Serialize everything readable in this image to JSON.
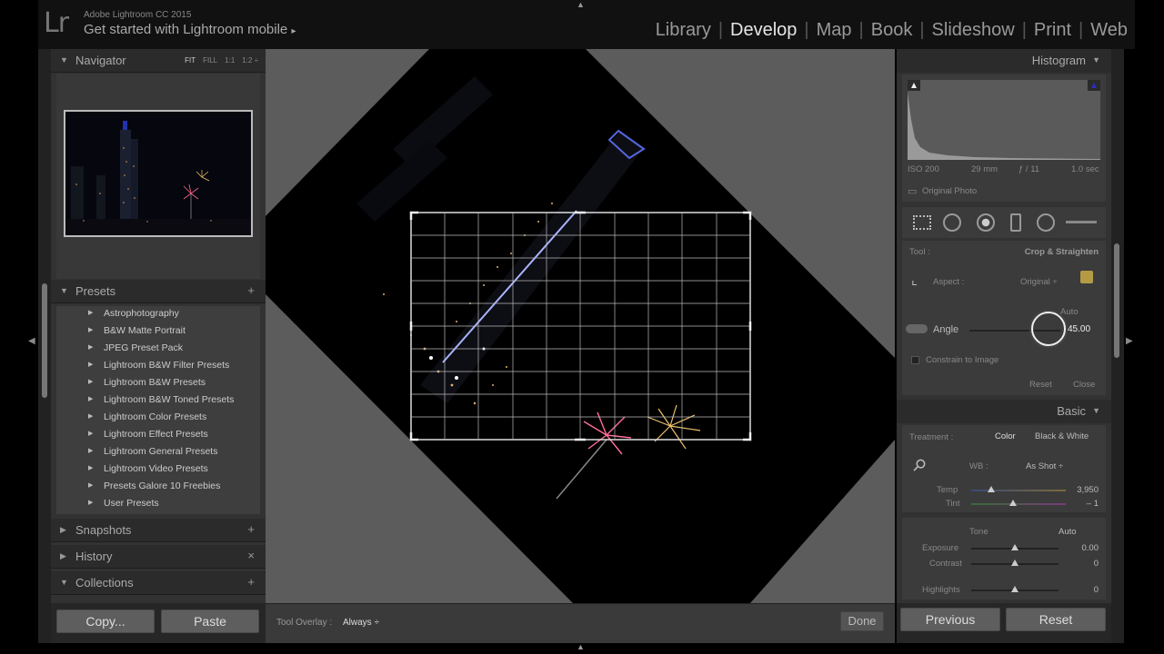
{
  "app": {
    "logo": "Lr",
    "subtitle": "Adobe Lightroom CC 2015",
    "title": "Get started with Lightroom mobile",
    "title_arrow": "▸"
  },
  "modules": [
    "Library",
    "Develop",
    "Map",
    "Book",
    "Slideshow",
    "Print",
    "Web"
  ],
  "active_module": "Develop",
  "navigator": {
    "title": "Navigator",
    "zoom_options": [
      "FIT",
      "FILL",
      "1:1",
      "1:2 ÷"
    ]
  },
  "presets": {
    "title": "Presets",
    "add": "+",
    "items": [
      "Astrophotography",
      "B&W Matte Portrait",
      "JPEG Preset Pack",
      "Lightroom B&W Filter Presets",
      "Lightroom B&W Presets",
      "Lightroom B&W Toned Presets",
      "Lightroom Color Presets",
      "Lightroom Effect Presets",
      "Lightroom General Presets",
      "Lightroom Video Presets",
      "Presets Galore 10 Freebies",
      "User Presets"
    ]
  },
  "snapshots": {
    "title": "Snapshots",
    "action": "+"
  },
  "history": {
    "title": "History",
    "action": "×"
  },
  "collections": {
    "title": "Collections",
    "action": "+"
  },
  "left_buttons": {
    "copy": "Copy...",
    "paste": "Paste"
  },
  "toolbar": {
    "overlay_label": "Tool Overlay :",
    "overlay_value": "Always ÷",
    "done": "Done"
  },
  "histogram": {
    "title": "Histogram",
    "iso": "ISO 200",
    "focal": "29 mm",
    "aperture": "ƒ / 11",
    "shutter": "1.0 sec",
    "original": "Original Photo"
  },
  "crop": {
    "tool_label": "Tool :",
    "tool_value": "Crop & Straighten",
    "aspect_label": "Aspect :",
    "aspect_value": "Original ÷",
    "auto": "Auto",
    "angle_label": "Angle",
    "angle_value": "45.00",
    "constrain": "Constrain to Image",
    "reset": "Reset",
    "close": "Close"
  },
  "basic": {
    "title": "Basic",
    "treatment_label": "Treatment :",
    "color": "Color",
    "bw": "Black & White",
    "wb_label": "WB :",
    "wb_value": "As Shot ÷",
    "temp_label": "Temp",
    "temp_value": "3,950",
    "tint_label": "Tint",
    "tint_value": "– 1",
    "tone_label": "Tone",
    "tone_auto": "Auto",
    "exposure_label": "Exposure",
    "exposure_value": "0.00",
    "contrast_label": "Contrast",
    "contrast_value": "0",
    "highlights_label": "Highlights",
    "highlights_value": "0"
  },
  "right_buttons": {
    "previous": "Previous",
    "reset": "Reset"
  },
  "colors": {
    "active_module": "#e6e6e6",
    "panel": "#323232",
    "center_bg": "#5c5c5c"
  }
}
